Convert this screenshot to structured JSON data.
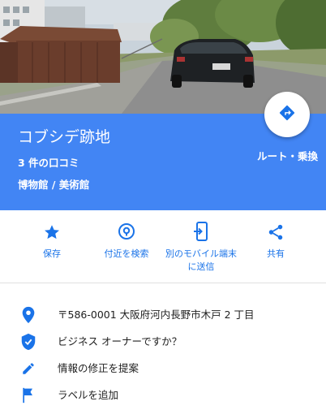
{
  "place": {
    "name": "コブシデ跡地",
    "reviews": "3 件の口コミ",
    "category": "博物館 / 美術館"
  },
  "route": {
    "label": "ルート・乗換"
  },
  "actions": [
    {
      "icon": "star-icon",
      "label": "保存"
    },
    {
      "icon": "location-pin-icon",
      "label": "付近を検索"
    },
    {
      "icon": "send-to-phone-icon",
      "label": "別のモバイル端末に送信"
    },
    {
      "icon": "share-icon",
      "label": "共有"
    }
  ],
  "details": [
    {
      "icon": "map-marker-icon",
      "text": "〒586-0001 大阪府河内長野市木戸 2 丁目"
    },
    {
      "icon": "verified-shield-icon",
      "text": "ビジネス オーナーですか？"
    },
    {
      "icon": "pencil-icon",
      "text": "情報の修正を提案"
    },
    {
      "icon": "flag-icon",
      "text": "ラベルを追加"
    }
  ],
  "colors": {
    "accent": "#4285f4",
    "action_text": "#1a73e8",
    "icon_blue": "#1a73e8"
  }
}
